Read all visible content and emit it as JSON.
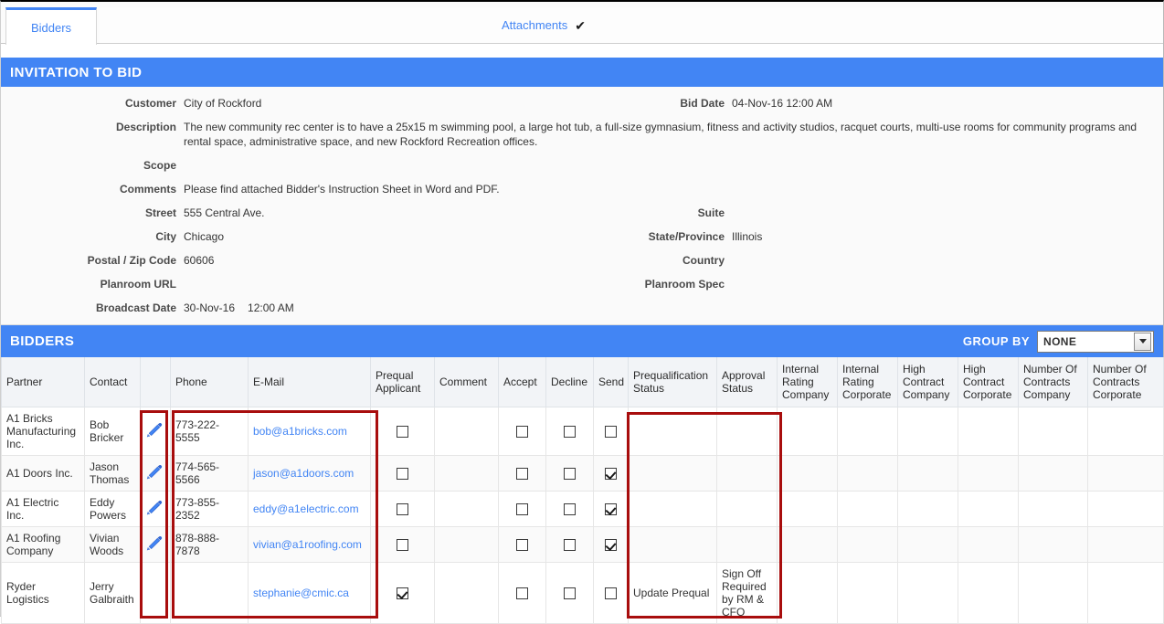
{
  "tabs": {
    "bidders": "Bidders",
    "attachments": "Attachments",
    "attachments_check": "✔"
  },
  "invitation": {
    "header": "INVITATION TO BID",
    "fields": {
      "customer_label": "Customer",
      "customer_value": "City of Rockford",
      "bid_date_label": "Bid Date",
      "bid_date_value": "04-Nov-16 12:00 AM",
      "description_label": "Description",
      "description_value": "The new community rec center is to have a 25x15 m swimming pool, a large hot tub, a full-size gymnasium, fitness and activity studios, racquet courts, multi-use rooms for community programs and rental space, administrative space, and new Rockford Recreation offices.",
      "scope_label": "Scope",
      "scope_value": "",
      "comments_label": "Comments",
      "comments_value": "Please find attached Bidder's Instruction Sheet in Word and PDF.",
      "street_label": "Street",
      "street_value": "555 Central Ave.",
      "suite_label": "Suite",
      "suite_value": "",
      "city_label": "City",
      "city_value": "Chicago",
      "state_label": "State/Province",
      "state_value": "Illinois",
      "postal_label": "Postal / Zip Code",
      "postal_value": "60606",
      "country_label": "Country",
      "country_value": "",
      "planroom_url_label": "Planroom URL",
      "planroom_url_value": "",
      "planroom_spec_label": "Planroom Spec",
      "planroom_spec_value": "",
      "broadcast_label": "Broadcast Date",
      "broadcast_date": "30-Nov-16",
      "broadcast_time": "12:00 AM"
    }
  },
  "bidders": {
    "header": "BIDDERS",
    "group_by_label": "GROUP BY",
    "group_by_value": "NONE",
    "columns": [
      "Partner",
      "Contact",
      "",
      "Phone",
      "E-Mail",
      "Prequal Applicant",
      "Comment",
      "Accept",
      "Decline",
      "Send",
      "Prequalification Status",
      "Approval Status",
      "Internal Rating Company",
      "Internal Rating Corporate",
      "High Contract Company",
      "High Contract Corporate",
      "Number Of Contracts Company",
      "Number Of Contracts Corporate"
    ],
    "rows": [
      {
        "partner": "A1 Bricks Manufacturing Inc.",
        "contact": "Bob Bricker",
        "edit": true,
        "phone": "773-222-5555",
        "email": "bob@a1bricks.com",
        "prequal_applicant": false,
        "comment": "",
        "accept": false,
        "decline": false,
        "send": false,
        "prequalification_status": "",
        "approval_status": "",
        "internal_rating_company": "",
        "internal_rating_corporate": "",
        "high_contract_company": "",
        "high_contract_corporate": "",
        "number_of_contracts_company": "",
        "number_of_contracts_corporate": ""
      },
      {
        "partner": "A1 Doors Inc.",
        "contact": "Jason Thomas",
        "edit": true,
        "phone": "774-565-5566",
        "email": "jason@a1doors.com",
        "prequal_applicant": false,
        "comment": "",
        "accept": false,
        "decline": false,
        "send": true,
        "prequalification_status": "",
        "approval_status": "",
        "internal_rating_company": "",
        "internal_rating_corporate": "",
        "high_contract_company": "",
        "high_contract_corporate": "",
        "number_of_contracts_company": "",
        "number_of_contracts_corporate": ""
      },
      {
        "partner": "A1 Electric Inc.",
        "contact": "Eddy Powers",
        "edit": true,
        "phone": "773-855-2352",
        "email": "eddy@a1electric.com",
        "prequal_applicant": false,
        "comment": "",
        "accept": false,
        "decline": false,
        "send": true,
        "prequalification_status": "",
        "approval_status": "",
        "internal_rating_company": "",
        "internal_rating_corporate": "",
        "high_contract_company": "",
        "high_contract_corporate": "",
        "number_of_contracts_company": "",
        "number_of_contracts_corporate": ""
      },
      {
        "partner": "A1 Roofing Company",
        "contact": "Vivian Woods",
        "edit": true,
        "phone": "878-888-7878",
        "email": "vivian@a1roofing.com",
        "prequal_applicant": false,
        "comment": "",
        "accept": false,
        "decline": false,
        "send": true,
        "prequalification_status": "",
        "approval_status": "",
        "internal_rating_company": "",
        "internal_rating_corporate": "",
        "high_contract_company": "",
        "high_contract_corporate": "",
        "number_of_contracts_company": "",
        "number_of_contracts_corporate": ""
      },
      {
        "partner": "Ryder Logistics",
        "contact": "Jerry Galbraith",
        "edit": false,
        "phone": "",
        "email": "stephanie@cmic.ca",
        "prequal_applicant": true,
        "comment": "",
        "accept": false,
        "decline": false,
        "send": false,
        "prequalification_status": "Update Prequal",
        "approval_status": "Sign Off Required by RM & CFO",
        "internal_rating_company": "",
        "internal_rating_corporate": "",
        "high_contract_company": "",
        "high_contract_corporate": "",
        "number_of_contracts_company": "",
        "number_of_contracts_corporate": ""
      }
    ]
  },
  "colors": {
    "accent_blue": "#4285f4",
    "link_blue": "#4285f4",
    "annotation_red": "#a80d0d",
    "header_grey": "#f2f4f7"
  }
}
